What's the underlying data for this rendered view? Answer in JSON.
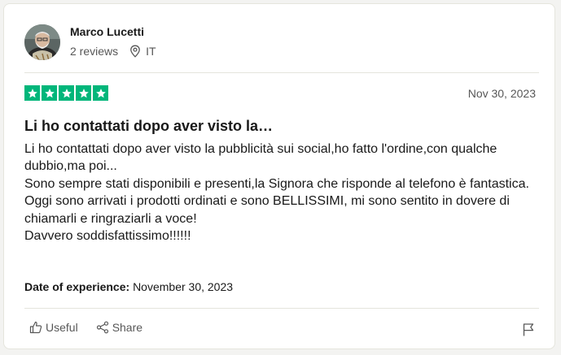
{
  "reviewer": {
    "name": "Marco Lucetti",
    "reviews": "2 reviews",
    "country": "IT",
    "avatar_icon": "user-photo",
    "location_icon": "location-pin-icon"
  },
  "review": {
    "rating": 5,
    "star_color": "#00b67a",
    "date": "Nov 30, 2023",
    "title": "Li ho contattati dopo aver visto la…",
    "body_lines": [
      "Li ho contattati dopo aver visto la pubblicità sui social,ho fatto l'ordine,con qualche dubbio,ma poi...",
      "Sono sempre stati disponibili e presenti,la Signora che risponde al telefono è fantastica.",
      "Oggi sono arrivati i prodotti ordinati e sono BELLISSIMI, mi sono sentito in dovere di chiamarli e ringraziarli a voce!",
      "Davvero soddisfattissimo!!!!!!"
    ],
    "experience_label": "Date of experience:",
    "experience_date": "November 30, 2023"
  },
  "actions": {
    "useful_label": "Useful",
    "share_label": "Share",
    "useful_icon": "thumbs-up-icon",
    "share_icon": "share-icon",
    "flag_icon": "flag-icon"
  }
}
